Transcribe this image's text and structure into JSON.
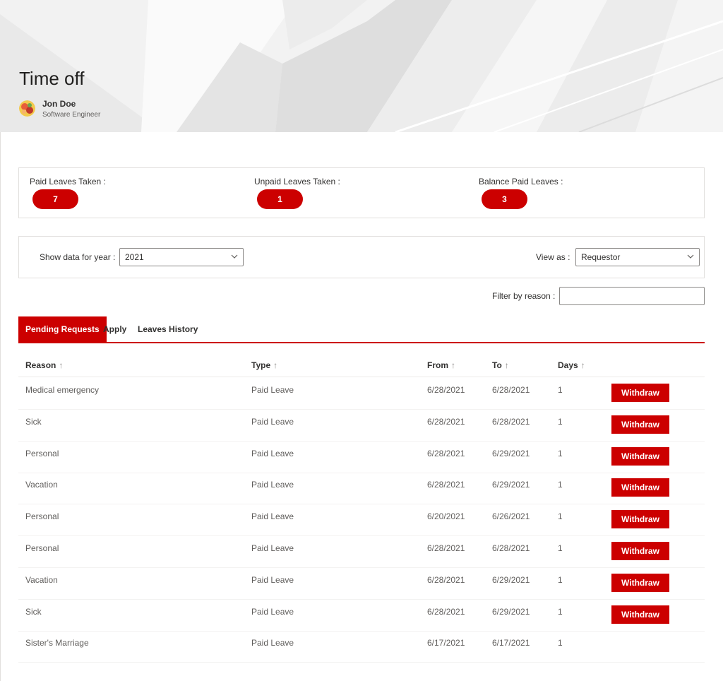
{
  "header": {
    "title": "Time off",
    "user": {
      "name": "Jon Doe",
      "role": "Software Engineer"
    }
  },
  "stats": [
    {
      "label": "Paid Leaves Taken :",
      "value": "7"
    },
    {
      "label": "Unpaid Leaves Taken :",
      "value": "1"
    },
    {
      "label": "Balance Paid Leaves :",
      "value": "3"
    }
  ],
  "filters": {
    "year_label": "Show data for year :",
    "year_value": "2021",
    "view_label": "View as :",
    "view_value": "Requestor",
    "reason_label": "Filter by reason :",
    "reason_value": ""
  },
  "tabs": [
    {
      "label": "Pending Requests",
      "active": true
    },
    {
      "label": "Apply",
      "active": false
    },
    {
      "label": "Leaves History",
      "active": false
    }
  ],
  "table": {
    "columns": [
      "Reason",
      "Type",
      "From",
      "To",
      "Days"
    ],
    "sort_glyph": "↑",
    "action_label": "Withdraw",
    "rows": [
      {
        "reason": "Medical emergency",
        "type": "Paid Leave",
        "from": "6/28/2021",
        "to": "6/28/2021",
        "days": "1",
        "withdraw": true
      },
      {
        "reason": "Sick",
        "type": "Paid Leave",
        "from": "6/28/2021",
        "to": "6/28/2021",
        "days": "1",
        "withdraw": true
      },
      {
        "reason": "Personal",
        "type": "Paid Leave",
        "from": "6/28/2021",
        "to": "6/29/2021",
        "days": "1",
        "withdraw": true
      },
      {
        "reason": "Vacation",
        "type": "Paid Leave",
        "from": "6/28/2021",
        "to": "6/29/2021",
        "days": "1",
        "withdraw": true
      },
      {
        "reason": "Personal",
        "type": "Paid Leave",
        "from": "6/20/2021",
        "to": "6/26/2021",
        "days": "1",
        "withdraw": true
      },
      {
        "reason": "Personal",
        "type": "Paid Leave",
        "from": "6/28/2021",
        "to": "6/28/2021",
        "days": "1",
        "withdraw": true
      },
      {
        "reason": "Vacation",
        "type": "Paid Leave",
        "from": "6/28/2021",
        "to": "6/29/2021",
        "days": "1",
        "withdraw": true
      },
      {
        "reason": "Sick",
        "type": "Paid Leave",
        "from": "6/28/2021",
        "to": "6/29/2021",
        "days": "1",
        "withdraw": true
      },
      {
        "reason": "Sister's Marriage",
        "type": "Paid Leave",
        "from": "6/17/2021",
        "to": "6/17/2021",
        "days": "1",
        "withdraw": false
      }
    ]
  },
  "theme": {
    "accent": "#cc0000",
    "border": "#e1dfdd"
  },
  "icons": {
    "avatar": "user-avatar-icon",
    "dropdown": "chevron-down-icon",
    "sort": "sort-arrow-icon"
  }
}
